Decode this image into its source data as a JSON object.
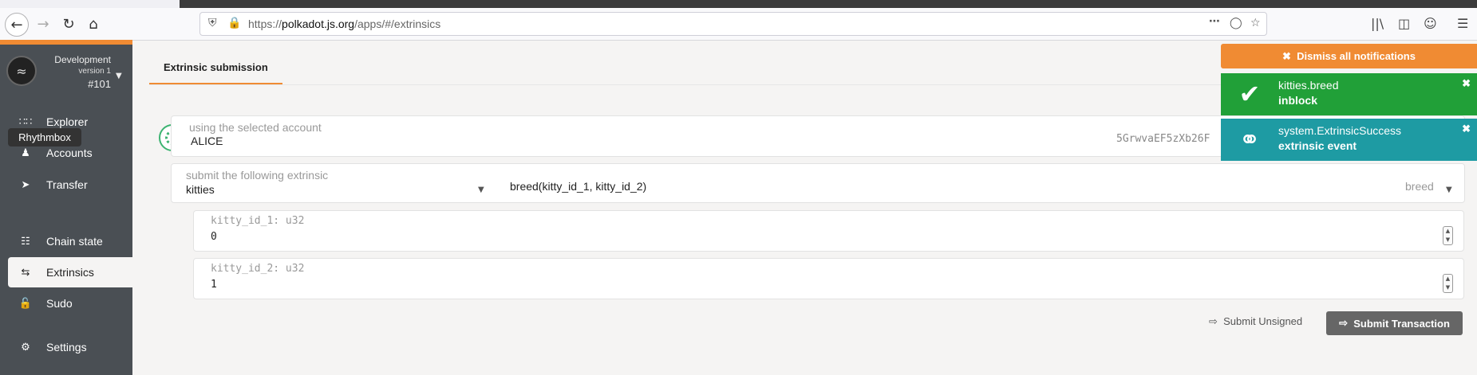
{
  "browser": {
    "url_prefix": "https://",
    "url_domain": "polkadot.js.org",
    "url_path": "/apps/#/extrinsics"
  },
  "sidebar": {
    "chain_name": "Development",
    "chain_version": "version 1",
    "chain_block": "#101",
    "tooltip": "Rhythmbox",
    "items": [
      {
        "label": "Explorer",
        "icon": "grid-icon"
      },
      {
        "label": "Accounts",
        "icon": "users-icon"
      },
      {
        "label": "Transfer",
        "icon": "paper-plane-icon"
      },
      {
        "label": "Chain state",
        "icon": "database-icon"
      },
      {
        "label": "Extrinsics",
        "icon": "sync-icon"
      },
      {
        "label": "Sudo",
        "icon": "unlock-icon"
      },
      {
        "label": "Settings",
        "icon": "cogs-icon"
      }
    ]
  },
  "main": {
    "tab_label": "Extrinsic submission",
    "account": {
      "label": "using the selected account",
      "name": "ALICE",
      "address": "5GrwvaEF5zXb26F"
    },
    "extrinsic": {
      "label": "submit the following extrinsic",
      "module": "kitties",
      "method_signature": "breed(kitty_id_1, kitty_id_2)",
      "method_selected": "breed"
    },
    "params": [
      {
        "label": "kitty_id_1: u32",
        "value": "0"
      },
      {
        "label": "kitty_id_2: u32",
        "value": "1"
      }
    ],
    "buttons": {
      "submit_unsigned": "Submit Unsigned",
      "submit_transaction": "Submit Transaction"
    }
  },
  "notifications": {
    "dismiss_all": "Dismiss all notifications",
    "items": [
      {
        "title": "kitties.breed",
        "status": "inblock",
        "color": "#21a038",
        "icon": "check-icon"
      },
      {
        "title": "system.ExtrinsicSuccess",
        "status": "extrinsic event",
        "color": "#1e9ba3",
        "icon": "assistive-listening-icon"
      }
    ]
  },
  "colors": {
    "accent": "#f08b33",
    "sidebar_bg": "#4a4f54"
  }
}
